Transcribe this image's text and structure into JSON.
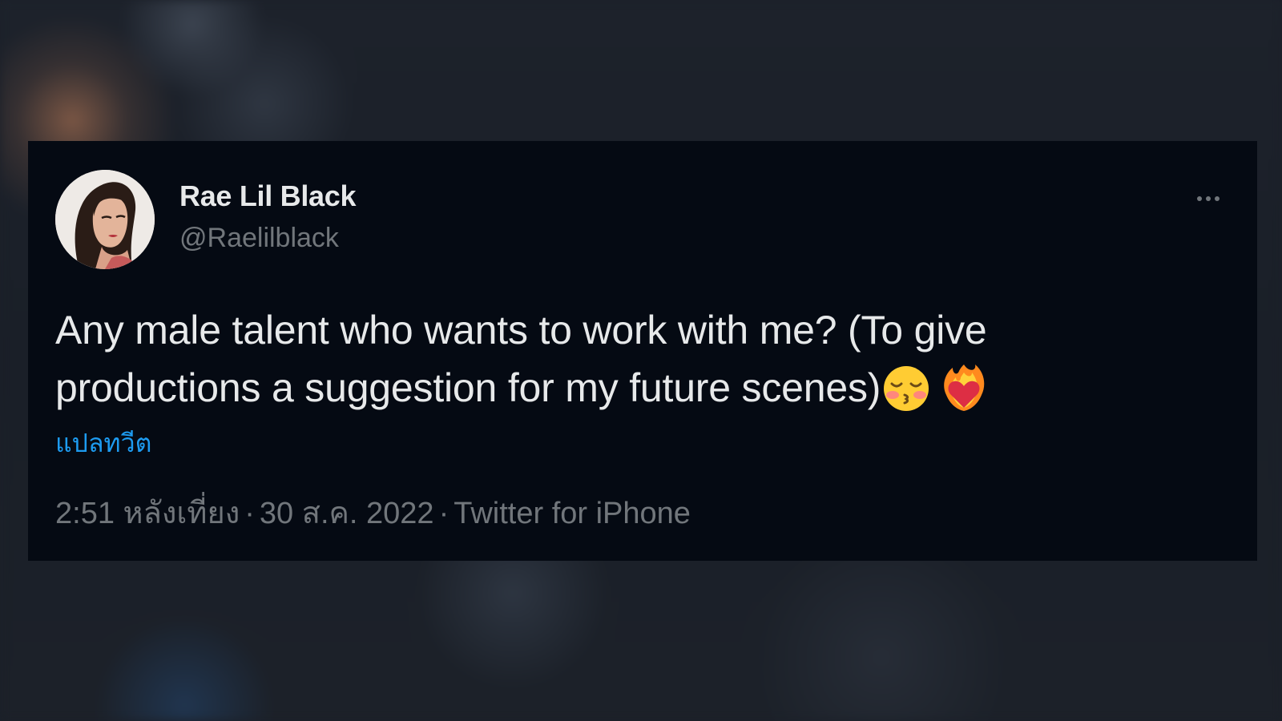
{
  "tweet": {
    "author": {
      "name": "Rae Lil Black",
      "handle": "@Raelilblack",
      "avatar_icon": "profile-photo"
    },
    "text": "Any male talent who wants to work with me? (To give productions a suggestion for my future scenes)",
    "emojis": [
      "kissing-face-with-closed-eyes",
      "heart-on-fire"
    ],
    "translate_label": "แปลทวีต",
    "meta": {
      "time": "2:51 หลังเที่ยง",
      "separator": "·",
      "date": "30 ส.ค. 2022",
      "source": "Twitter for iPhone"
    },
    "more_icon": "more-horizontal-icon"
  },
  "colors": {
    "card_background": "#050a13",
    "page_background": "#1b2029",
    "primary_text": "#e7e9ea",
    "secondary_text": "#71767b",
    "link": "#1d9bf0"
  }
}
